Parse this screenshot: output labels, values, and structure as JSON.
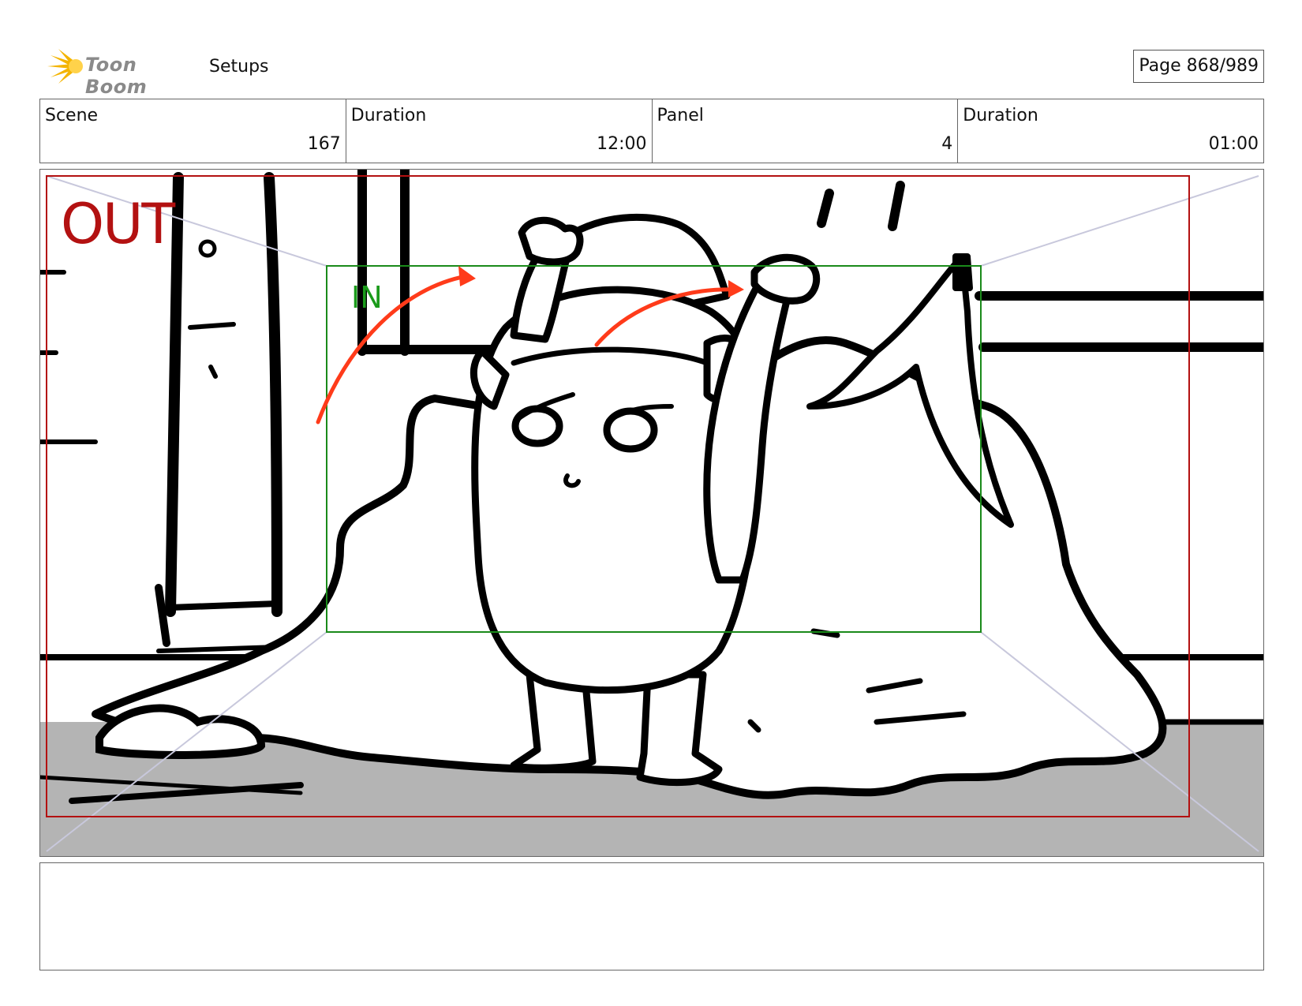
{
  "header": {
    "logo_text": "Toon Boom",
    "section": "Setups",
    "page": "Page 868/989"
  },
  "info": [
    {
      "label": "Scene",
      "value": "167"
    },
    {
      "label": "Duration",
      "value": "12:00"
    },
    {
      "label": "Panel",
      "value": "4"
    },
    {
      "label": "Duration",
      "value": "01:00"
    }
  ],
  "panel": {
    "out_label": "OUT",
    "in_label": "IN",
    "colors": {
      "out_frame": "#b31111",
      "in_frame": "#1a8a1a",
      "motion_arrow": "#ff3b1a",
      "floor": "#b4b4b4"
    }
  },
  "notes": {
    "text": ""
  }
}
